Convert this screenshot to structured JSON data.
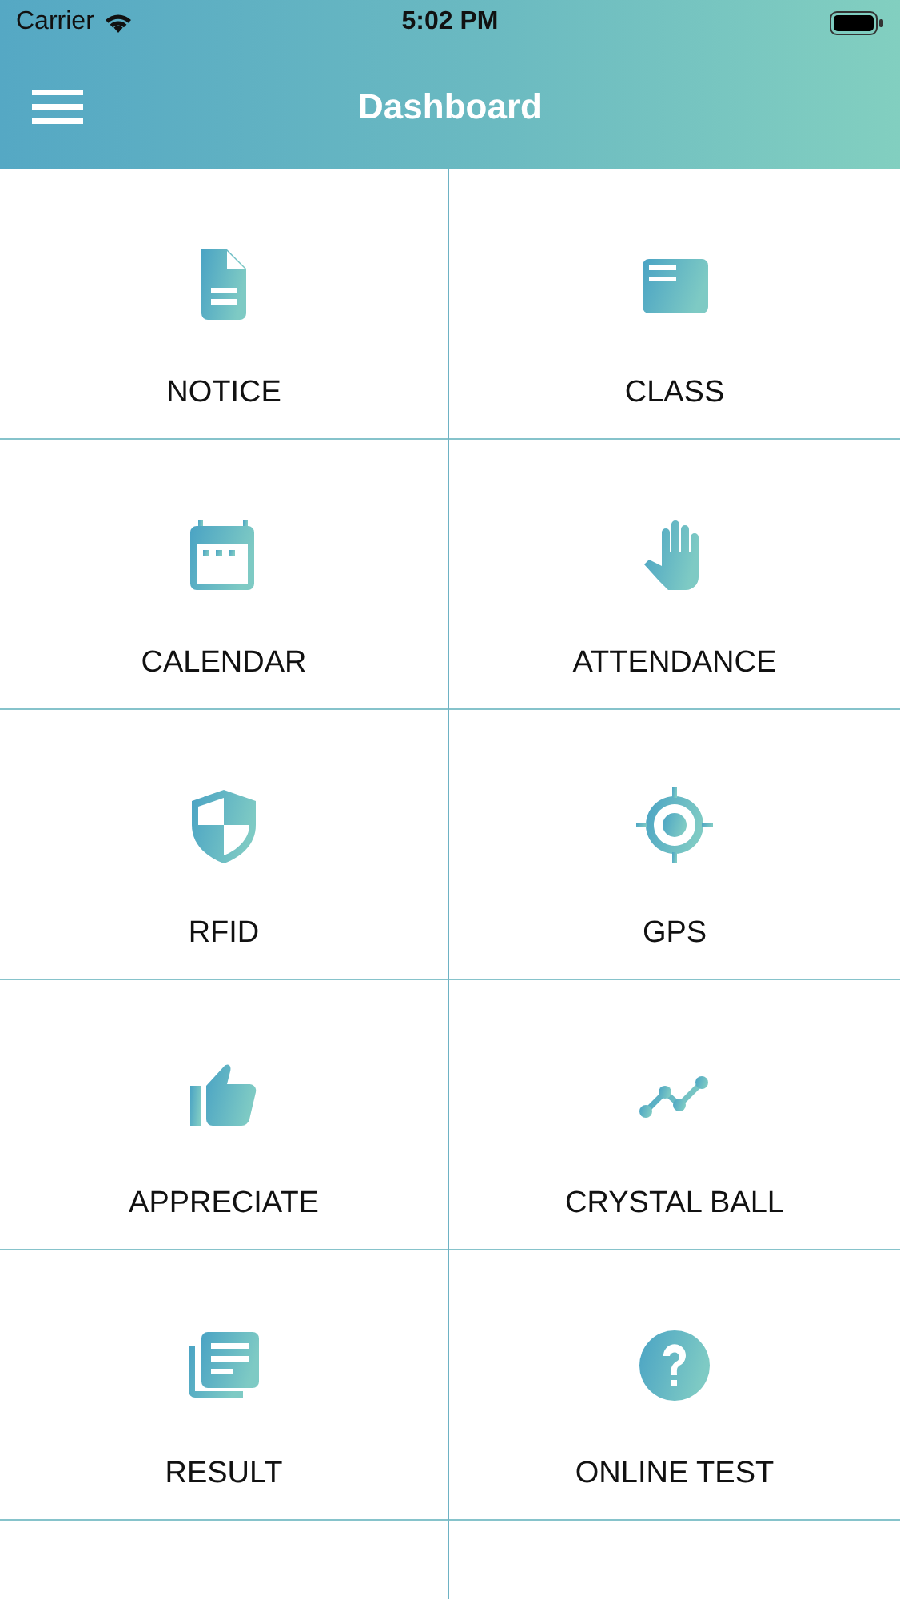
{
  "status_bar": {
    "carrier": "Carrier",
    "time": "5:02 PM"
  },
  "nav_bar": {
    "title": "Dashboard"
  },
  "tiles": [
    {
      "label": "NOTICE",
      "kind": "document"
    },
    {
      "label": "CLASS",
      "kind": "card"
    },
    {
      "label": "CALENDAR",
      "kind": "calendar"
    },
    {
      "label": "ATTENDANCE",
      "kind": "hand"
    },
    {
      "label": "RFID",
      "kind": "shield"
    },
    {
      "label": "GPS",
      "kind": "target"
    },
    {
      "label": "APPRECIATE",
      "kind": "thumb"
    },
    {
      "label": "CRYSTAL BALL",
      "kind": "trend"
    },
    {
      "label": "RESULT",
      "kind": "stack"
    },
    {
      "label": "ONLINE TEST",
      "kind": "question"
    }
  ]
}
